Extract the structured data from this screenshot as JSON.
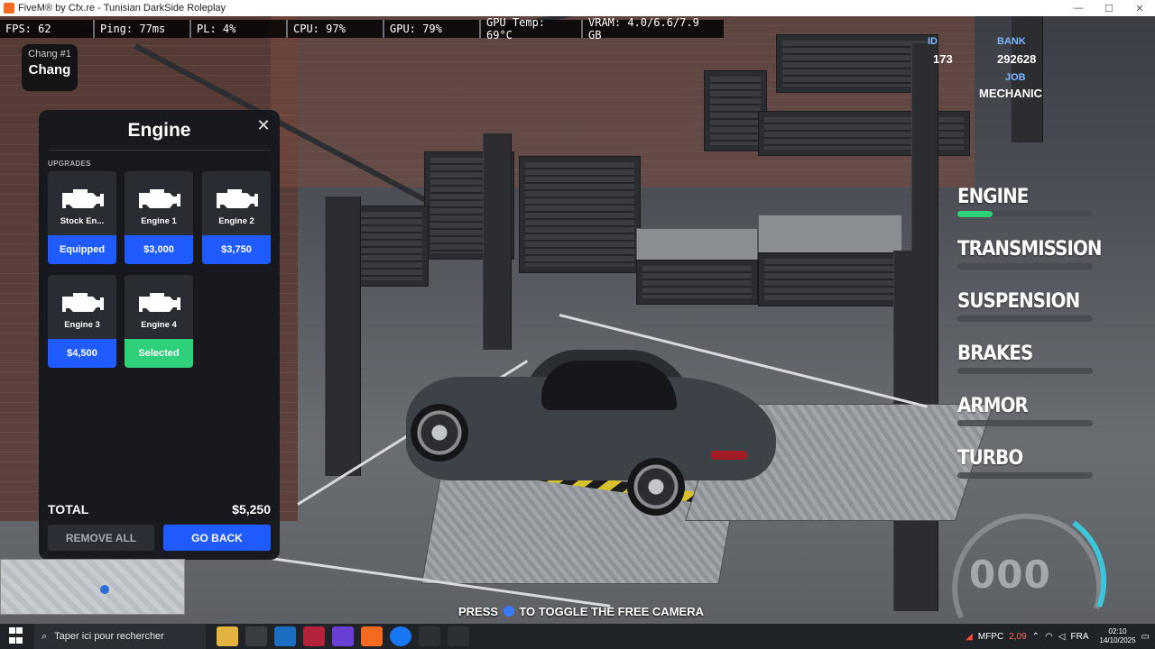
{
  "window": {
    "title": "FiveM® by Cfx.re - Tunisian DarkSide Roleplay",
    "controls": [
      "—",
      "☐",
      "✕"
    ]
  },
  "stats": [
    {
      "label": "FPS: 62"
    },
    {
      "label": "Ping: 77ms"
    },
    {
      "label": "PL: 4%"
    },
    {
      "label": "CPU: 97%"
    },
    {
      "label": "GPU: 79%"
    },
    {
      "label": "GPU Temp: 69°C"
    },
    {
      "label": "VRAM: 4.0/6.6/7.9 GB"
    }
  ],
  "player": {
    "handle": "Chang #1",
    "name": "Chang"
  },
  "top_right": {
    "id_label": "ID",
    "id_value": "173",
    "bank_label": "BANK",
    "bank_value": "292628",
    "job_label": "JOB",
    "job_value": "MECHANIC"
  },
  "panel": {
    "title": "Engine",
    "close": "✕",
    "section_label": "UPGRADES",
    "items": [
      {
        "name": "Stock En...",
        "action": "Equipped",
        "state": "equipped"
      },
      {
        "name": "Engine 1",
        "action": "$3,000",
        "state": "price"
      },
      {
        "name": "Engine 2",
        "action": "$3,750",
        "state": "price"
      },
      {
        "name": "Engine 3",
        "action": "$4,500",
        "state": "price"
      },
      {
        "name": "Engine 4",
        "action": "Selected",
        "state": "selected"
      }
    ],
    "total_label": "TOTAL",
    "total_value": "$5,250",
    "remove_all": "REMOVE ALL",
    "go_back": "GO BACK"
  },
  "categories": [
    {
      "name": "ENGINE",
      "level": 0.26
    },
    {
      "name": "TRANSMISSION",
      "level": 0
    },
    {
      "name": "SUSPENSION",
      "level": 0
    },
    {
      "name": "BRAKES",
      "level": 0
    },
    {
      "name": "ARMOR",
      "level": 0
    },
    {
      "name": "TURBO",
      "level": 0
    }
  ],
  "speedometer": {
    "value": "000"
  },
  "hint": {
    "before": "PRESS",
    "after": "TO TOGGLE THE FREE CAMERA"
  },
  "taskbar": {
    "search_placeholder": "Taper ici pour rechercher",
    "tray_label": "MFPC",
    "tray_temp": "2,09",
    "lang": "FRA",
    "time": "02:10",
    "date": "14/10/2025"
  },
  "colors": {
    "accent_blue": "#1f5bff",
    "accent_green": "#2fd07a"
  }
}
